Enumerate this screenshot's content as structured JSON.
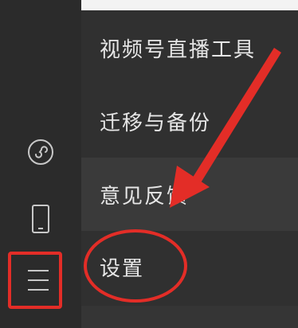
{
  "sidebar": {
    "icons": [
      {
        "name": "mini-program-icon"
      },
      {
        "name": "phone-icon"
      },
      {
        "name": "menu-icon"
      }
    ]
  },
  "menu": {
    "items": [
      {
        "label": "视频号直播工具"
      },
      {
        "label": "迁移与备份"
      },
      {
        "label": "意见反馈"
      },
      {
        "label": "设置"
      }
    ]
  },
  "annotation": {
    "color": "#e32d27"
  }
}
